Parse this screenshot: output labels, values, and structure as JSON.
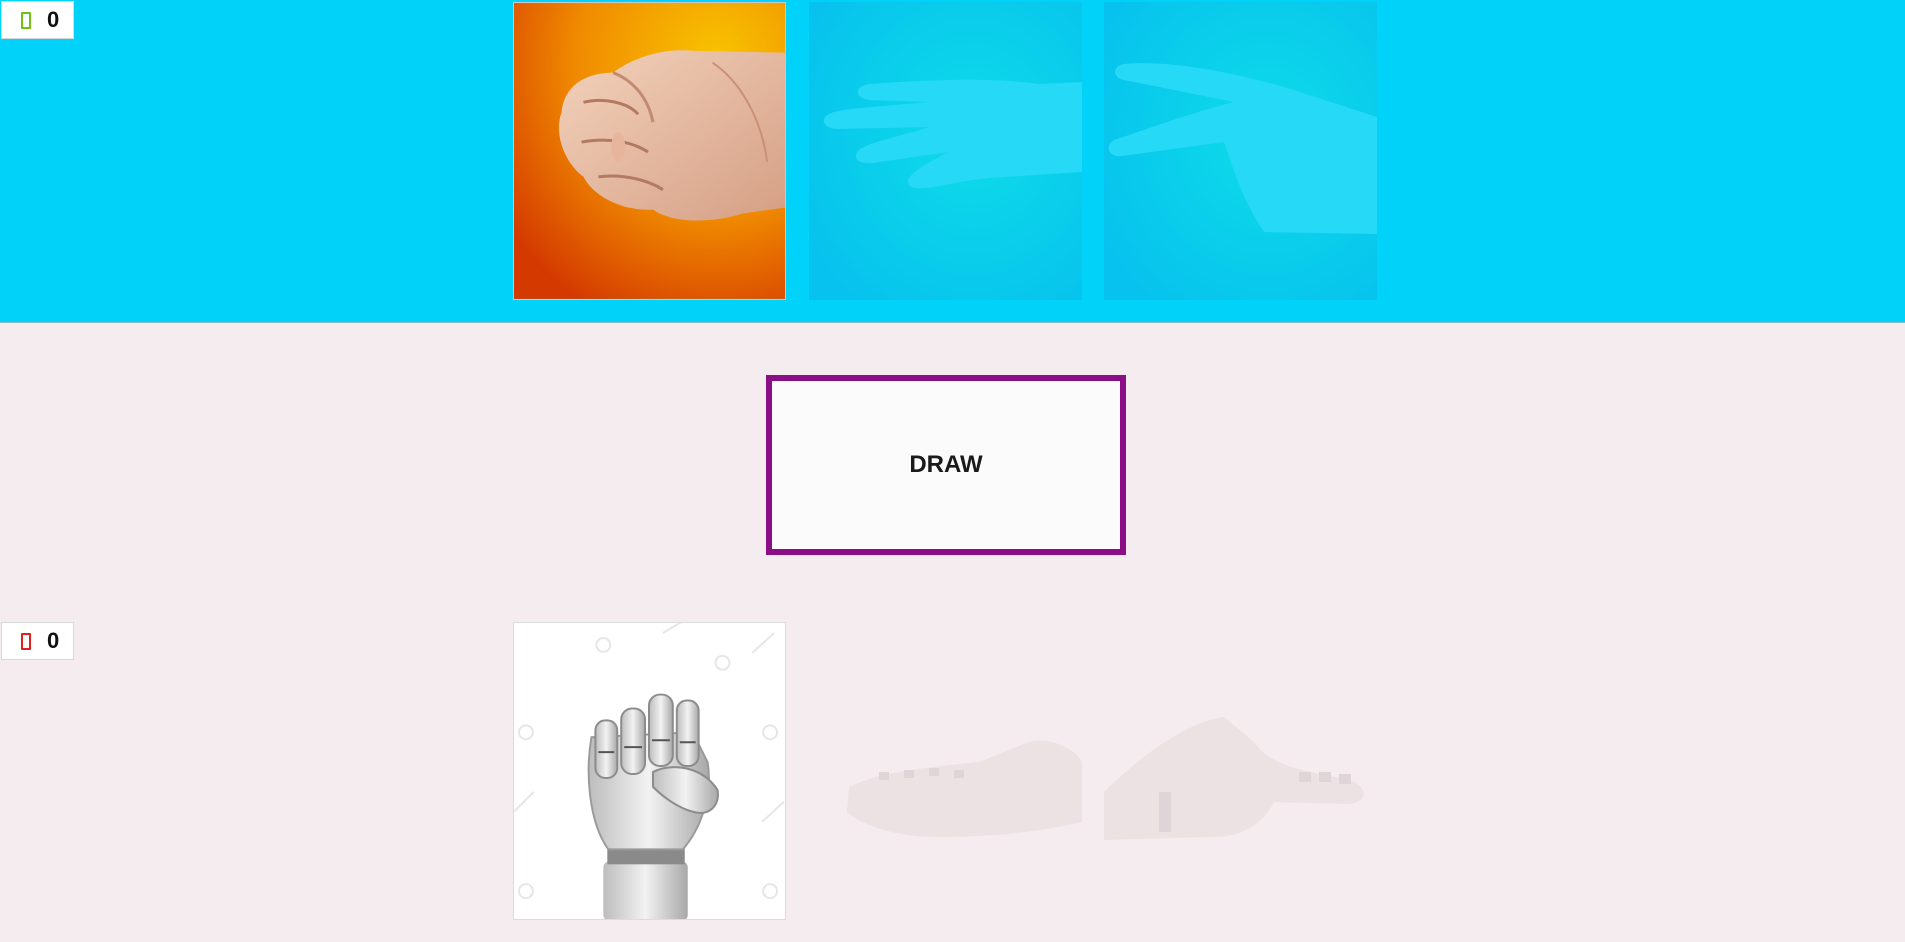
{
  "player": {
    "score": "0",
    "score_icon": "green-rectangle-icon",
    "score_icon_color": "#6bc414",
    "choices": [
      {
        "name": "rock",
        "selected": true
      },
      {
        "name": "paper",
        "selected": false
      },
      {
        "name": "scissors",
        "selected": false
      }
    ]
  },
  "computer": {
    "score": "0",
    "score_icon": "red-rectangle-icon",
    "score_icon_color": "#e02020",
    "choices": [
      {
        "name": "rock",
        "selected": true
      },
      {
        "name": "paper",
        "selected": false
      },
      {
        "name": "scissors",
        "selected": false
      }
    ]
  },
  "result": {
    "label": "DRAW",
    "border_color": "#8b0e86"
  },
  "colors": {
    "player_area": "#00d2fa",
    "computer_area": "#f4ecee"
  }
}
